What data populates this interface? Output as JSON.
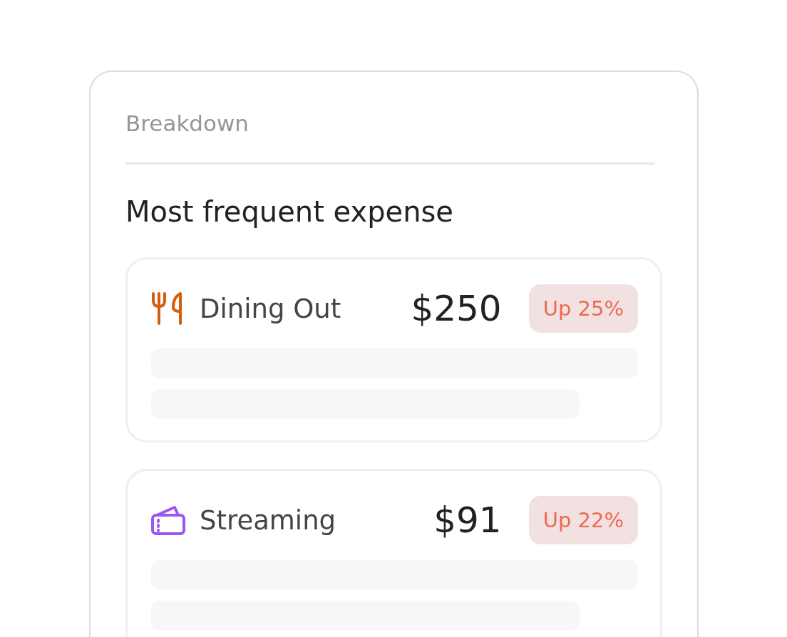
{
  "panel": {
    "title": "Breakdown",
    "heading": "Most frequent expense"
  },
  "expenses": [
    {
      "kind": "dining",
      "color": "#d35f0e",
      "label": "Dining Out",
      "amount": "$250",
      "change": "Up 25%"
    },
    {
      "kind": "streaming",
      "color": "#9b55f4",
      "label": "Streaming",
      "amount": "$91",
      "change": "Up 22%"
    }
  ]
}
